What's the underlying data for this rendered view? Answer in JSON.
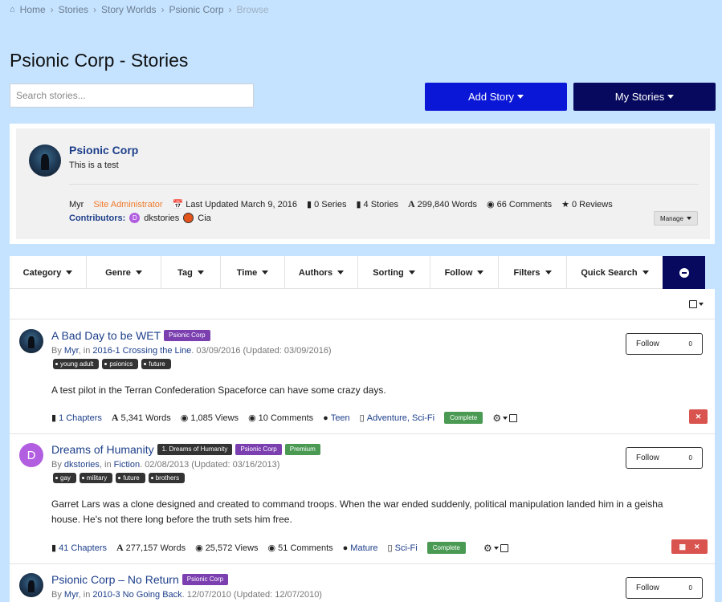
{
  "breadcrumb": {
    "home": "Home",
    "items": [
      "Stories",
      "Story Worlds",
      "Psionic Corp"
    ],
    "current": "Browse"
  },
  "page_title": "Psionic Corp - Stories",
  "search": {
    "placeholder": "Search stories..."
  },
  "buttons": {
    "add_story": "Add Story",
    "my_stories": "My Stories"
  },
  "profile": {
    "name": "Psionic Corp",
    "description": "This is a test",
    "owner": "Myr",
    "role": "Site Administrator",
    "last_updated": "Last Updated March 9, 2016",
    "series": "0 Series",
    "stories": "4 Stories",
    "words": "299,840 Words",
    "comments": "66 Comments",
    "reviews": "0 Reviews",
    "contributors_label": "Contributors:",
    "contributors": [
      {
        "initial": "D",
        "name": "dkstories",
        "color": "#b15ee0"
      },
      {
        "initial": "",
        "name": "Cia",
        "color": "#e2541b"
      }
    ],
    "manage": "Manage"
  },
  "filters": [
    "Category",
    "Genre",
    "Tag",
    "Time",
    "Authors",
    "Sorting",
    "Follow",
    "Filters",
    "Quick Search"
  ],
  "stories": [
    {
      "title": "A Bad Day to be WET",
      "badges": [
        {
          "text": "Psionic Corp",
          "kind": "purple"
        }
      ],
      "by": "By ",
      "author": "Myr",
      "in": ", in ",
      "world": "2016-1 Crossing the Line",
      "dates": ". 03/09/2016 (Updated: 03/09/2016)",
      "tags": [
        "young adult",
        "psionics",
        "future"
      ],
      "summary": "A test pilot in the Terran Confederation Spaceforce can have some crazy days.",
      "chapters": "1 Chapters",
      "words": "5,341 Words",
      "views": "1,085 Views",
      "comments": "10 Comments",
      "rating": "Teen",
      "genres": "Adventure, Sci-Fi",
      "status": "Complete",
      "follow": "Follow",
      "follow_count": "0"
    },
    {
      "title": "Dreams of Humanity",
      "badges": [
        {
          "text": "1. Dreams of Humanity",
          "kind": "dark"
        },
        {
          "text": "Psionic Corp",
          "kind": "purple"
        },
        {
          "text": "Premium",
          "kind": "green"
        }
      ],
      "avatar_letter": "D",
      "by": "By ",
      "author": "dkstories",
      "in": ", in ",
      "world": "Fiction",
      "dates": ". 02/08/2013 (Updated: 03/16/2013)",
      "tags": [
        "gay",
        "military",
        "future",
        "brothers"
      ],
      "summary": "Garret Lars was a clone designed and created to command troops. When the war ended suddenly, political manipulation landed him in a geisha house. He's not there long before the truth sets him free.",
      "chapters": "41 Chapters",
      "words": "277,157 Words",
      "views": "25,572 Views",
      "comments": "51 Comments",
      "rating": "Mature",
      "genres": "Sci-Fi",
      "status": "Complete",
      "follow": "Follow",
      "follow_count": "0"
    },
    {
      "title": "Psionic Corp – No Return",
      "badges": [
        {
          "text": "Psionic Corp",
          "kind": "purple"
        }
      ],
      "by": "By ",
      "author": "Myr",
      "in": ", in ",
      "world": "2010-3 No Going Back",
      "dates": ". 12/07/2010 (Updated: 12/07/2010)",
      "follow": "Follow",
      "follow_count": "0"
    }
  ]
}
